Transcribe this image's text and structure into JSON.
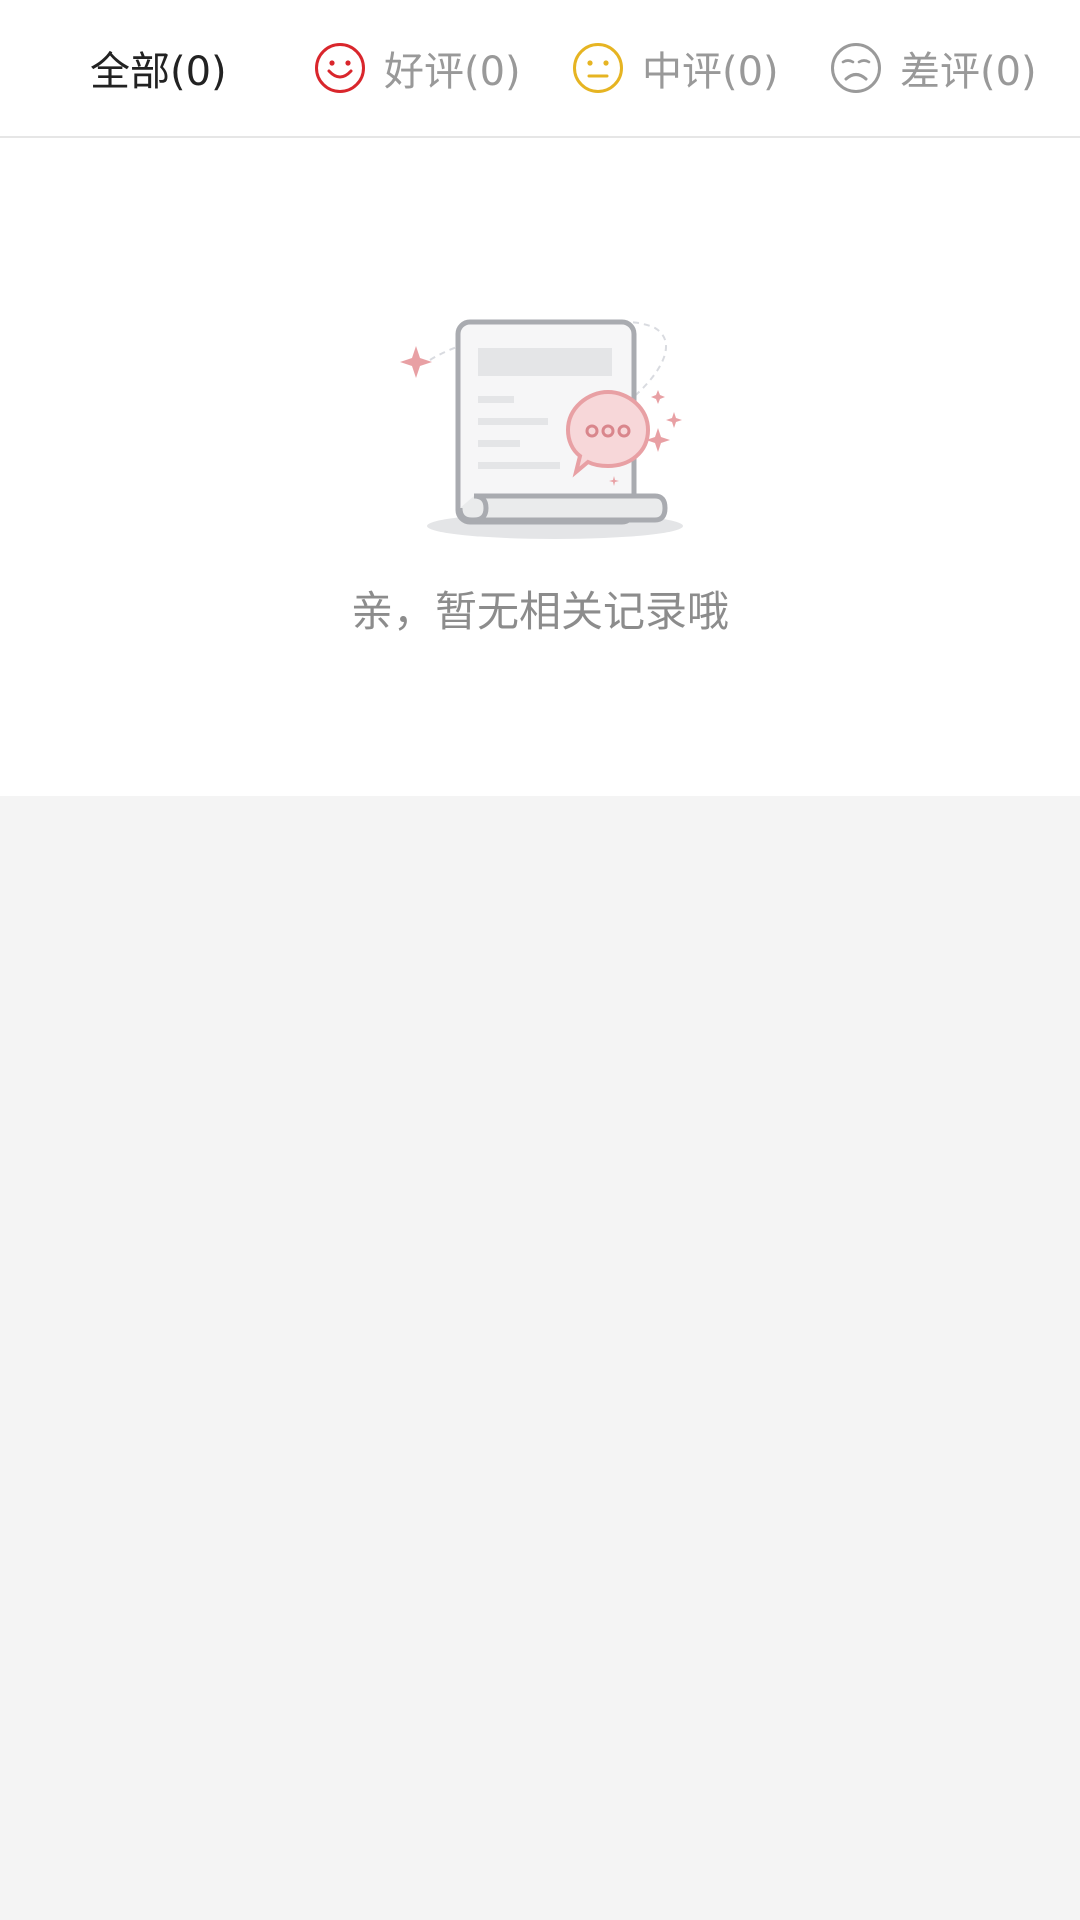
{
  "tabs": [
    {
      "label": "全部(0)",
      "icon": null,
      "active": true
    },
    {
      "label": "好评(0)",
      "icon": "smile-face-icon",
      "icon_color": "#d9262c",
      "active": false
    },
    {
      "label": "中评(0)",
      "icon": "neutral-face-icon",
      "icon_color": "#e6b422",
      "active": false
    },
    {
      "label": "差评(0)",
      "icon": "sad-face-icon",
      "icon_color": "#9a9a9a",
      "active": false
    }
  ],
  "empty_state": {
    "message": "亲，暂无相关记录哦",
    "illustration": "empty-document-chat-icon",
    "accent_color": "#e8a0a4"
  },
  "colors": {
    "page_background": "#f4f4f4",
    "surface": "#ffffff",
    "text_active": "#222222",
    "text_muted": "#999999"
  }
}
